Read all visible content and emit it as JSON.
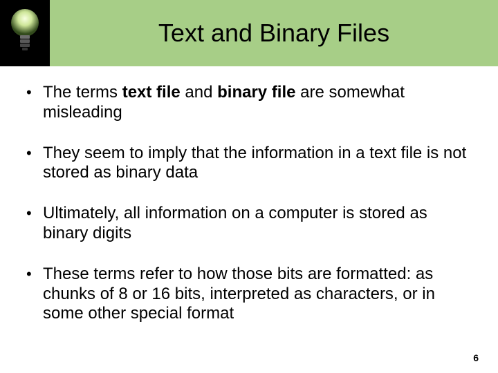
{
  "slide": {
    "title": "Text and Binary Files",
    "bullets": [
      {
        "segments": [
          {
            "text": "The terms ",
            "bold": false
          },
          {
            "text": "text file",
            "bold": true
          },
          {
            "text": " and ",
            "bold": false
          },
          {
            "text": "binary file",
            "bold": true
          },
          {
            "text": " are somewhat misleading",
            "bold": false
          }
        ]
      },
      {
        "segments": [
          {
            "text": "They seem to imply that the information in a text file is not stored as binary data",
            "bold": false
          }
        ]
      },
      {
        "segments": [
          {
            "text": "Ultimately, all information on a computer is stored as binary digits",
            "bold": false
          }
        ]
      },
      {
        "segments": [
          {
            "text": "These terms refer to how those bits are formatted: as chunks of 8 or 16 bits, interpreted as characters, or in some other special format",
            "bold": false
          }
        ]
      }
    ],
    "page_number": "6"
  }
}
